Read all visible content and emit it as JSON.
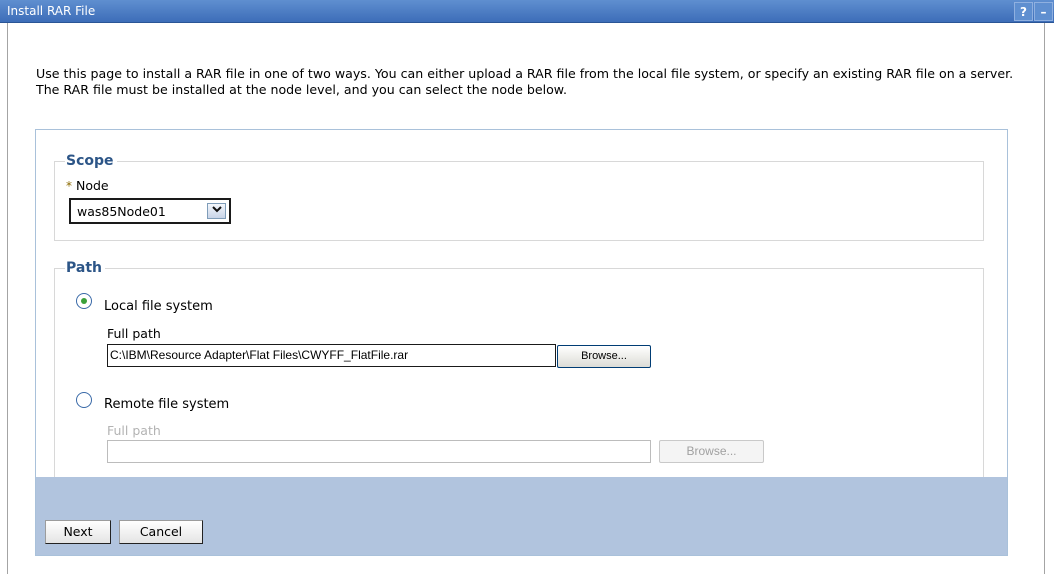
{
  "window": {
    "title": "Install RAR File",
    "help_label": "?",
    "minimize_label": "–"
  },
  "description": "Use this page to install a RAR file in one of two ways. You can either upload a RAR file from the local file system, or specify an existing RAR file on a server. The RAR file must be installed at the node level, and you can select the node below.",
  "scope": {
    "legend": "Scope",
    "required_marker": "*",
    "node_label": "Node",
    "node_value": "was85Node01"
  },
  "path": {
    "legend": "Path",
    "local": {
      "label": "Local file system",
      "selected": true,
      "full_path_label": "Full path",
      "full_path_value": "C:\\IBM\\Resource Adapter\\Flat Files\\CWYFF_FlatFile.rar",
      "browse_label": "Browse..."
    },
    "remote": {
      "label": "Remote file system",
      "selected": false,
      "full_path_label": "Full path",
      "full_path_value": "",
      "browse_label": "Browse..."
    }
  },
  "buttons": {
    "next": "Next",
    "cancel": "Cancel"
  },
  "colors": {
    "titlebar": "#4a7bc4",
    "legend_text": "#2c5587",
    "footer": "#b1c4de",
    "radio_selected": "#3aa03a"
  },
  "icons": {
    "dropdown": "chevron-down-icon"
  }
}
